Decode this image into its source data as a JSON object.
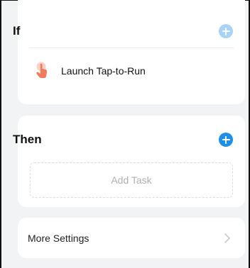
{
  "if_section": {
    "title": "If",
    "add_icon": "plus-circle-icon",
    "conditions": [
      {
        "icon": "tap-hand-icon",
        "label": "Launch Tap-to-Run"
      }
    ]
  },
  "then_section": {
    "title": "Then",
    "add_icon": "plus-circle-icon",
    "add_task_label": "Add Task"
  },
  "more_settings": {
    "label": "More Settings",
    "icon": "chevron-right-icon"
  },
  "colors": {
    "accent": "#1f8ee8",
    "accent_light": "#a9d2f7",
    "tap_icon": "#f07a5a",
    "background": "#f2f3f5"
  }
}
